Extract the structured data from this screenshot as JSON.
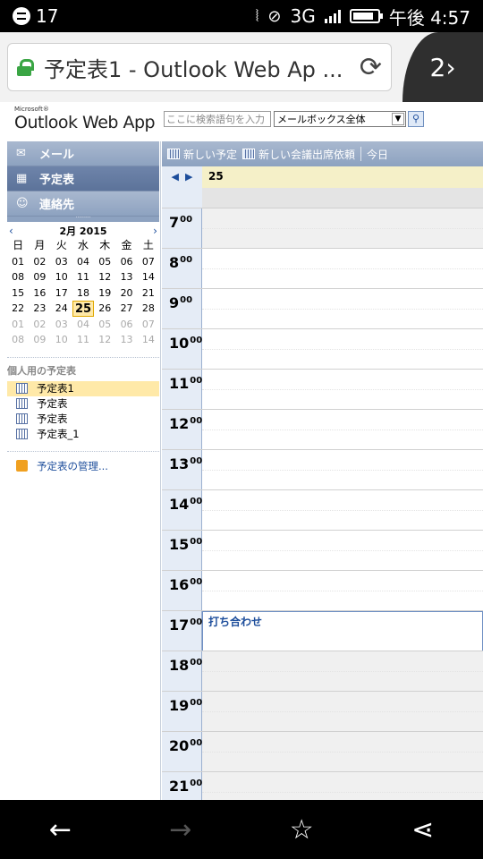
{
  "status": {
    "notif_count": "17",
    "network": "3G",
    "time": "午後 4:57"
  },
  "browser": {
    "title": "予定表1 - Outlook Web Ap ...",
    "tab_count": "2"
  },
  "owa": {
    "logo_small": "Microsoft®",
    "logo": "Outlook Web App",
    "search_placeholder": "ここに検索語句を入力",
    "scope": "メールボックス全体"
  },
  "nav": {
    "mail": "メール",
    "calendar": "予定表",
    "contacts": "連絡先"
  },
  "mini_cal": {
    "month": "2月 2015",
    "dow": [
      "日",
      "月",
      "火",
      "水",
      "木",
      "金",
      "土"
    ],
    "weeks": [
      [
        "01",
        "02",
        "03",
        "04",
        "05",
        "06",
        "07"
      ],
      [
        "08",
        "09",
        "10",
        "11",
        "12",
        "13",
        "14"
      ],
      [
        "15",
        "16",
        "17",
        "18",
        "19",
        "20",
        "21"
      ],
      [
        "22",
        "23",
        "24",
        "25",
        "26",
        "27",
        "28"
      ],
      [
        "01",
        "02",
        "03",
        "04",
        "05",
        "06",
        "07"
      ],
      [
        "08",
        "09",
        "10",
        "11",
        "12",
        "13",
        "14"
      ]
    ]
  },
  "personal": {
    "section": "個人用の予定表",
    "calendars": [
      "予定表1",
      "予定表",
      "予定表",
      "予定表_1"
    ],
    "manage": "予定表の管理..."
  },
  "toolbar": {
    "new_appt": "新しい予定",
    "new_meeting": "新しい会議出席依頼",
    "today": "今日"
  },
  "day": {
    "label": "25"
  },
  "hours": [
    "7",
    "8",
    "9",
    "10",
    "11",
    "12",
    "13",
    "14",
    "15",
    "16",
    "17",
    "18",
    "19",
    "20",
    "21"
  ],
  "minute_label": "00",
  "event": {
    "title": "打ち合わせ"
  },
  "colors": {
    "nav": "#8da2c0",
    "highlight": "#ffe9a8",
    "link": "#1c4d9b"
  }
}
